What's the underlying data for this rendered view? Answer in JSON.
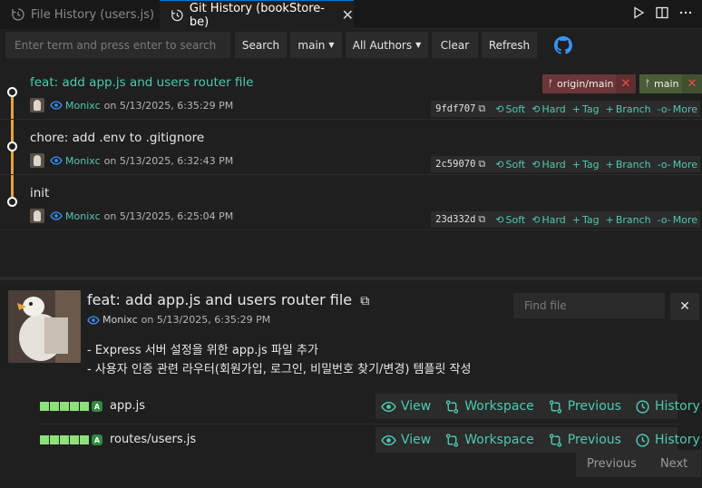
{
  "tabs": [
    {
      "label": "File History (users.js)",
      "active": false
    },
    {
      "label": "Git History (bookStore-be)",
      "active": true
    }
  ],
  "toolbar": {
    "search_placeholder": "Enter term and press enter to search",
    "search_label": "Search",
    "branch_label": "main",
    "authors_label": "All Authors",
    "clear_label": "Clear",
    "refresh_label": "Refresh"
  },
  "commits": [
    {
      "title": "feat: add app.js and users router file",
      "author": "Monixc",
      "date": "on 5/13/2025, 6:35:29 PM",
      "hash": "9fdf707"
    },
    {
      "title": "chore: add .env to .gitignore",
      "author": "Monixc",
      "date": "on 5/13/2025, 6:32:43 PM",
      "hash": "2c59070"
    },
    {
      "title": "init",
      "author": "Monixc",
      "date": "on 5/13/2025, 6:25:04 PM",
      "hash": "23d332d"
    }
  ],
  "commit_actions": {
    "soft": "Soft",
    "hard": "Hard",
    "tag": "Tag",
    "branch": "Branch",
    "more": "More"
  },
  "refs": [
    {
      "label": "origin/main"
    },
    {
      "label": "main"
    }
  ],
  "details": {
    "title": "feat: add app.js and users router file",
    "author": "Monixc",
    "date": "on 5/13/2025, 6:35:29 PM",
    "find_placeholder": "Find file",
    "description": [
      "- Express 서버 설정을 위한 app.js 파일 추가",
      "- 사용자 인증 관련 라우터(회원가입, 로그인, 비밀번호 찾기/변경) 템플릿 작성"
    ],
    "files": [
      {
        "name": "app.js",
        "status": "A",
        "changes": 5
      },
      {
        "name": "routes/users.js",
        "status": "A",
        "changes": 5
      }
    ],
    "file_actions": {
      "view": "View",
      "workspace": "Workspace",
      "previous": "Previous",
      "history": "History"
    }
  },
  "pager": {
    "previous": "Previous",
    "next": "Next"
  },
  "colors": {
    "accent": "#4ec9b0",
    "graph": "#e8a33d",
    "added_bar": "#8ee07a",
    "origin_badge": "#6b3637",
    "main_badge": "#4a5d37"
  }
}
